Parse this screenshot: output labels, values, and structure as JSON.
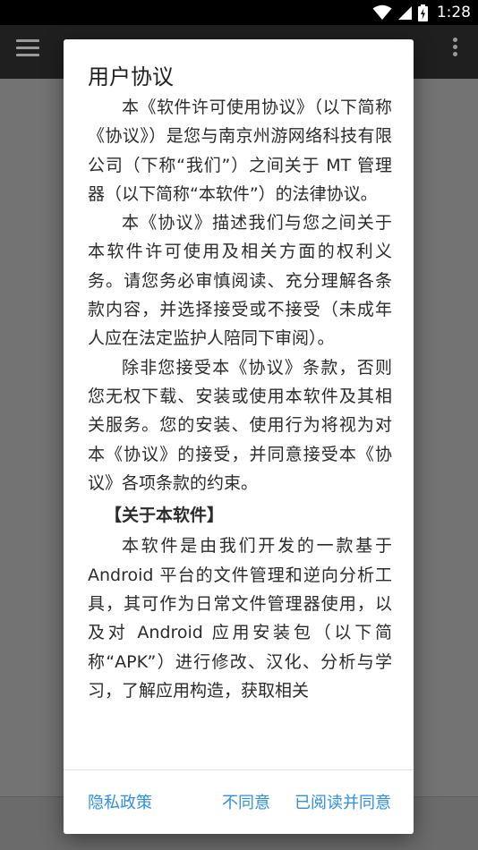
{
  "status_bar": {
    "time": "1:28",
    "icons": [
      "wifi-icon",
      "signal-icon",
      "battery-charging-icon"
    ]
  },
  "dialog": {
    "title": "用户协议",
    "paragraphs": [
      "本《软件许可使用协议》（以下简称《协议》）是您与南京州游网络科技有限公司（下称“我们”）之间关于 MT 管理器（以下简称“本软件”）的法律协议。",
      "本《协议》描述我们与您之间关于本软件许可使用及相关方面的权利义务。请您务必审慎阅读、充分理解各条款内容，并选择接受或不接受（未成年人应在法定监护人陪同下审阅）。",
      "除非您接受本《协议》条款，否则您无权下载、安装或使用本软件及其相关服务。您的安装、使用行为将视为对本《协议》的接受，并同意接受本《协议》各项条款的约束。"
    ],
    "section_heading": "【关于本软件】",
    "section_paragraphs": [
      "本软件是由我们开发的一款基于 Android 平台的文件管理和逆向分析工具，其可作为日常文件管理器使用，以及对 Android 应用安装包（以下简称“APK”）进行修改、汉化、分析与学习，了解应用构造，获取相关"
    ],
    "buttons": {
      "privacy": "隐私政策",
      "disagree": "不同意",
      "agree": "已阅读并同意"
    }
  }
}
